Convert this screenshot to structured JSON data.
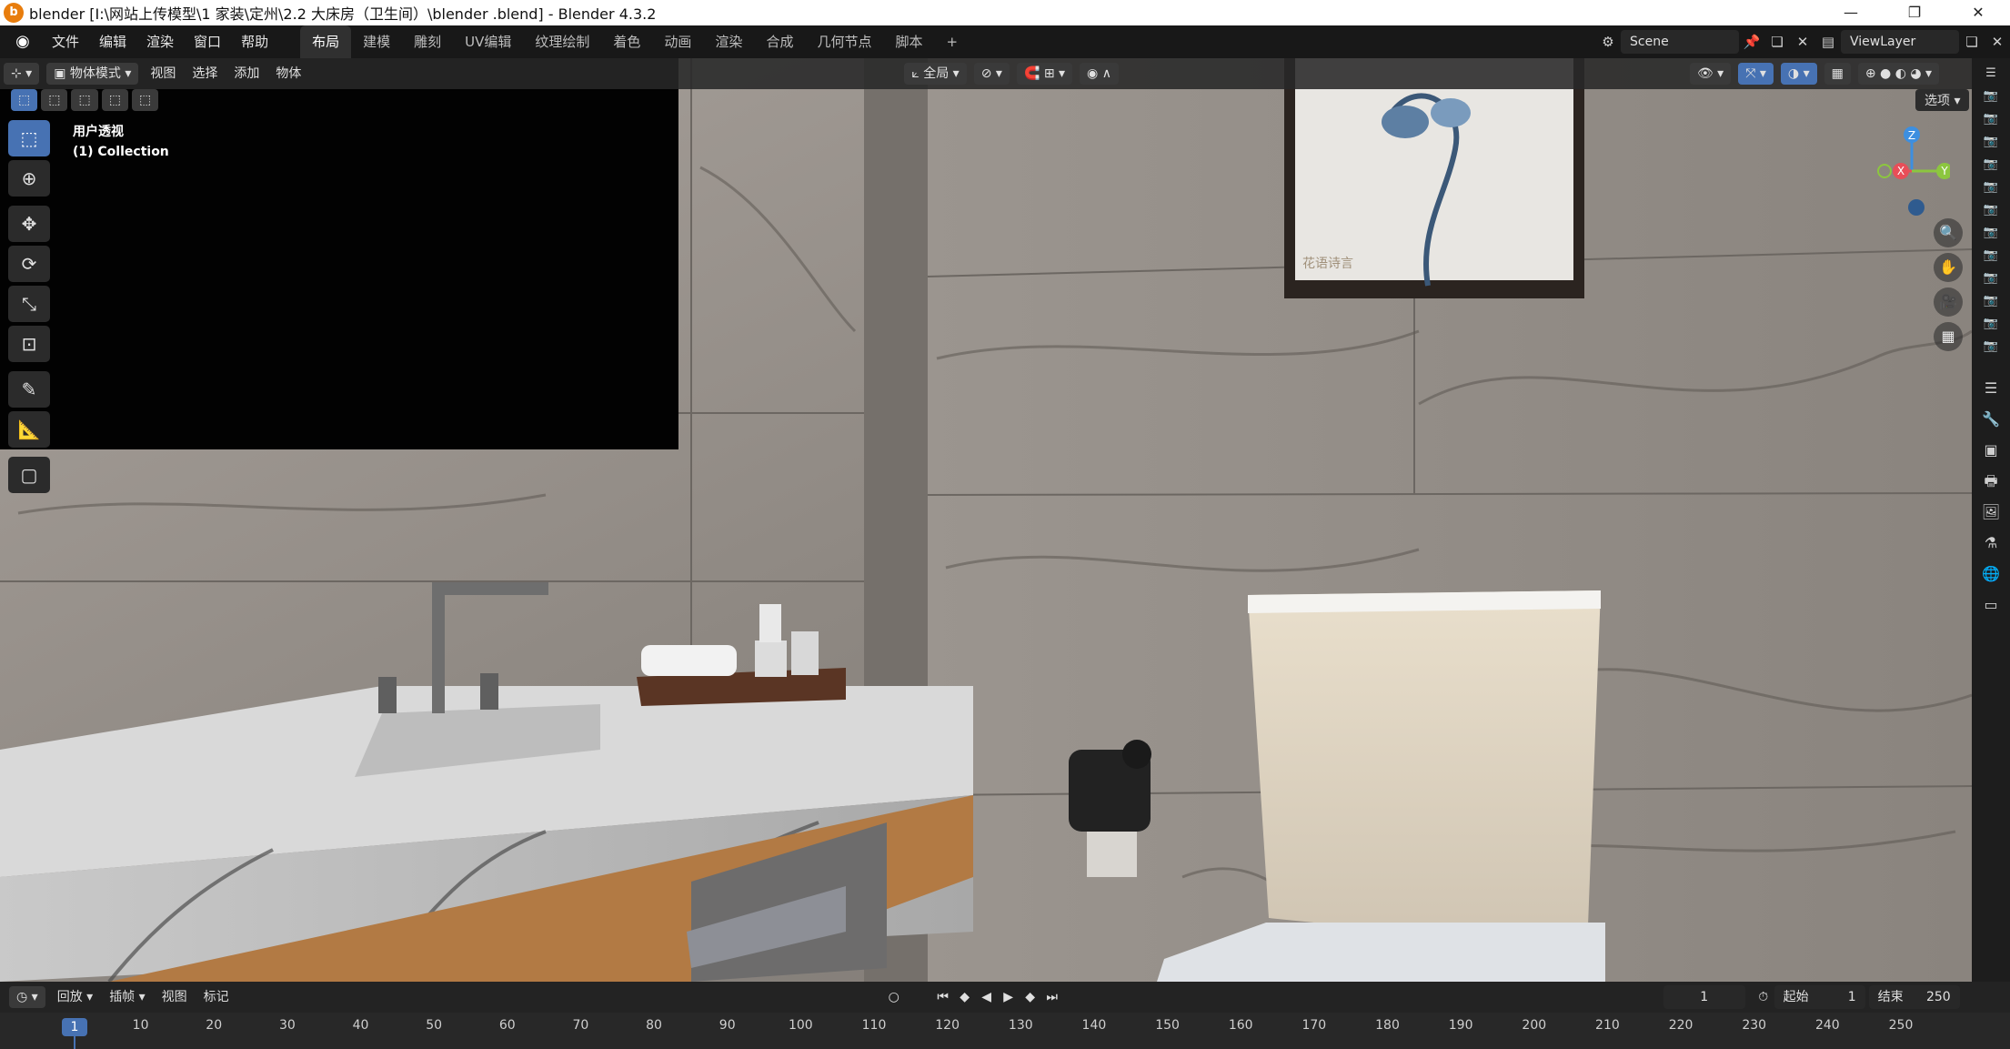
{
  "titlebar": {
    "title": "blender  [I:\\网站上传模型\\1 家装\\定州\\2.2 大床房（卫生间）\\blender .blend] - Blender 4.3.2",
    "minimize": "—",
    "maximize": "❐",
    "close": "✕"
  },
  "menubar": {
    "menus": [
      "文件",
      "编辑",
      "渲染",
      "窗口",
      "帮助"
    ],
    "workspaces": [
      "布局",
      "建模",
      "雕刻",
      "UV编辑",
      "纹理绘制",
      "着色",
      "动画",
      "渲染",
      "合成",
      "几何节点",
      "脚本"
    ],
    "active_workspace": "布局",
    "add_tab": "+",
    "scene_name": "Scene",
    "view_layer": "ViewLayer"
  },
  "viewport_header": {
    "mode": "物体模式",
    "menus": [
      "视图",
      "选择",
      "添加",
      "物体"
    ],
    "transform_orientation": "全局"
  },
  "viewport": {
    "view_name": "用户透视",
    "collection": "(1) Collection",
    "options_label": "选项",
    "gizmo": {
      "x": "X",
      "y": "Y",
      "z": "Z"
    },
    "picture_caption": "花语诗言"
  },
  "timeline": {
    "menus": [
      "回放",
      "插帧",
      "视图",
      "标记"
    ],
    "current_frame": "1",
    "start_label": "起始",
    "start_value": "1",
    "end_label": "结束",
    "end_value": "250",
    "ruler": [
      "1",
      "10",
      "20",
      "30",
      "40",
      "50",
      "60",
      "70",
      "80",
      "90",
      "100",
      "110",
      "120",
      "130",
      "140",
      "150",
      "160",
      "170",
      "180",
      "190",
      "200",
      "210",
      "220",
      "230",
      "240",
      "250"
    ]
  },
  "colors": {
    "accent": "#4772b3",
    "gizmo_x": "#e84e58",
    "gizmo_y": "#8cc63f",
    "gizmo_z": "#3d8fe0"
  }
}
